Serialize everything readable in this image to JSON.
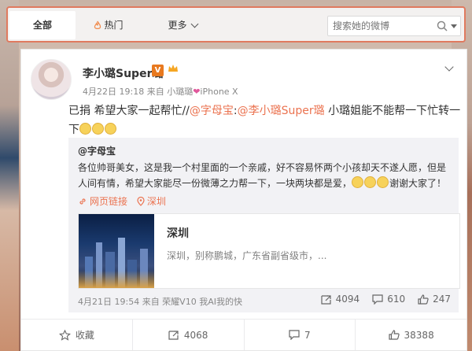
{
  "nav": {
    "tabs": [
      {
        "label": "全部"
      },
      {
        "label": "热门"
      },
      {
        "label": "更多"
      }
    ],
    "search_placeholder": "搜索她的微博"
  },
  "post": {
    "username": "李小璐Super璐",
    "verified_badge": "V",
    "date": "4月22日 19:18",
    "source_prefix": "来自",
    "source": "小璐璐",
    "source_suffix": "iPhone X",
    "text_intro": "已捐 希望大家一起帮忙//",
    "mention1": "@字母宝",
    "sep": ":",
    "mention2": "@李小璐Super璐",
    "text_tail": " 小璐姐能不能帮一下忙转一下"
  },
  "repost": {
    "author": "@字母宝",
    "text": "各位帅哥美女，这是我一个村里面的一个亲戚，好不容易怀两个小孩却天不遂人愿，但是人间有情，希望大家能尽一份微薄之力帮一下，一块两块都是爱，",
    "text_end": "谢谢大家了！",
    "link1": "网页链接",
    "link2": "深圳",
    "card_title": "深圳",
    "card_desc": "深圳，别称鹏城，广东省副省级市，...",
    "footer": "4月21日 19:54 来自 荣耀V10 我AI我的快",
    "forwards": "4094",
    "comments": "610",
    "likes": "247"
  },
  "actions": {
    "favorite": "收藏",
    "forward": "4068",
    "comment": "7",
    "like": "38388"
  },
  "colors": {
    "accent": "#eb7350",
    "highlight_border": "#e07a5f",
    "verified": "#e8791f"
  }
}
